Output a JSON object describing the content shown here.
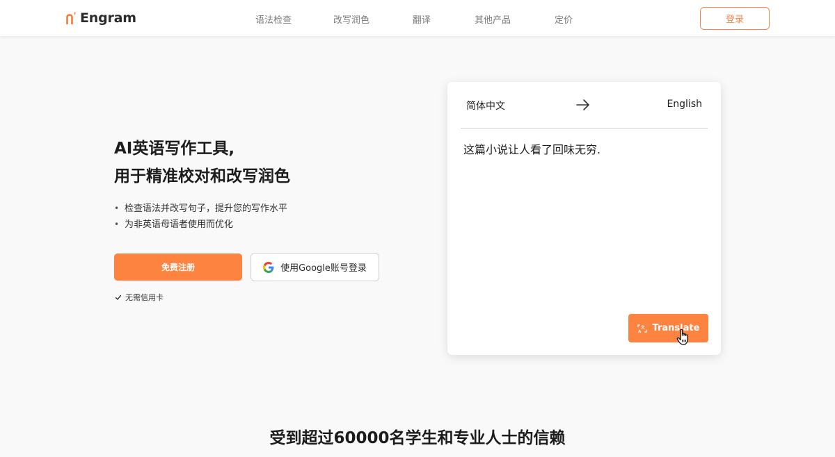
{
  "brand": {
    "name": "Engram",
    "accent_color": "#fd8340"
  },
  "nav": {
    "items": [
      {
        "label": "语法检查"
      },
      {
        "label": "改写润色"
      },
      {
        "label": "翻译"
      },
      {
        "label": "其他产品"
      },
      {
        "label": "定价"
      }
    ],
    "login_label": "登录"
  },
  "hero": {
    "title_line1": "AI英语写作工具,",
    "title_line2": "用于精准校对和改写润色",
    "bullets": [
      "检查语法并改写句子，提升您的写作水平",
      "为非英语母语者使用而优化"
    ],
    "signup_label": "免费注册",
    "google_label": "使用Google账号登录",
    "no_card_label": "无需信用卡"
  },
  "translator": {
    "source_lang": "简体中文",
    "target_lang": "English",
    "source_text": "这篇小说让人看了回味无穷.",
    "translate_label": "Translate",
    "icons": [
      "arrow-right-icon",
      "translate-icon",
      "hand-pointer-icon"
    ]
  },
  "trust": {
    "heading": "受到超过60000名学生和专业人士的信赖"
  }
}
